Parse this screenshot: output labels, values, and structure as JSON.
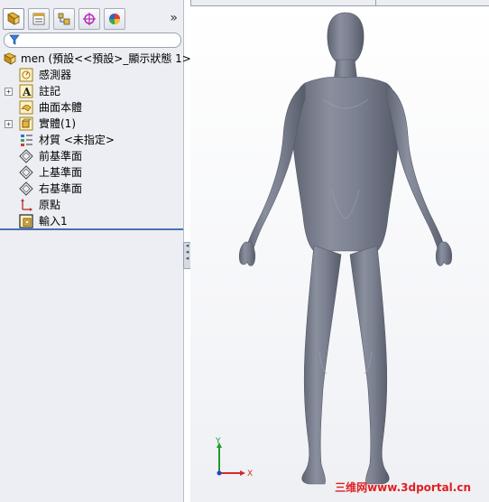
{
  "tabs": [
    {
      "name": "feature-manager"
    },
    {
      "name": "property-manager"
    },
    {
      "name": "configuration-manager"
    },
    {
      "name": "dimxpert-manager"
    },
    {
      "name": "display-manager"
    }
  ],
  "tabs_more": "»",
  "tree": {
    "root_label": "men  (預設<<預設>_顯示狀態 1>",
    "items": [
      {
        "label": "感測器",
        "icon": "sensor-icon",
        "expandable": false
      },
      {
        "label": "註記",
        "icon": "annotation-icon",
        "expandable": true
      },
      {
        "label": "曲面本體",
        "icon": "surface-bodies-icon",
        "expandable": false
      },
      {
        "label": "實體(1)",
        "icon": "solid-bodies-icon",
        "expandable": true
      },
      {
        "label": "材質 <未指定>",
        "icon": "material-icon",
        "expandable": false
      },
      {
        "label": "前基準面",
        "icon": "plane-icon",
        "expandable": false
      },
      {
        "label": "上基準面",
        "icon": "plane-icon",
        "expandable": false
      },
      {
        "label": "右基準面",
        "icon": "plane-icon",
        "expandable": false
      },
      {
        "label": "原點",
        "icon": "origin-icon",
        "expandable": false
      },
      {
        "label": "輸入1",
        "icon": "imported-feature-icon",
        "expandable": false
      }
    ]
  },
  "triad": {
    "y_label": "Y",
    "x_label": "X"
  },
  "watermark": "三维网www.3dportal.cn",
  "colors": {
    "model": "#7a7f8e",
    "panel": "#eceef3",
    "accent": "#4a6fb5",
    "watermark": "#e02020"
  }
}
